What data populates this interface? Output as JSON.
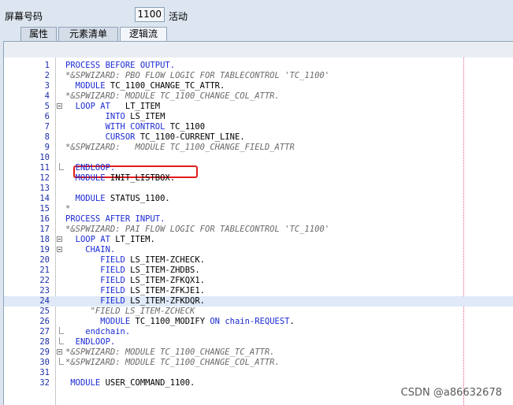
{
  "header": {
    "screen_number_label": "屏幕号码",
    "screen_number_value": "1100",
    "screen_status": "活动"
  },
  "tabs": [
    {
      "label": "属性",
      "active": false
    },
    {
      "label": "元素清单",
      "active": false
    },
    {
      "label": "逻辑流",
      "active": true
    }
  ],
  "code_lines": [
    {
      "n": "1",
      "fold": "",
      "parts": [
        {
          "t": "PROCESS BEFORE OUTPUT.",
          "c": "kw"
        }
      ]
    },
    {
      "n": "2",
      "fold": "",
      "parts": [
        {
          "t": "*&SPWIZARD: PBO FLOW LOGIC FOR TABLECONTROL 'TC_1100'",
          "c": "cm"
        }
      ]
    },
    {
      "n": "3",
      "fold": "",
      "parts": [
        {
          "t": "  MODULE",
          "c": "kw"
        },
        {
          "t": " TC_1100_CHANGE_TC_ATTR.",
          "c": ""
        }
      ]
    },
    {
      "n": "4",
      "fold": "",
      "parts": [
        {
          "t": "*&SPWIZARD: MODULE TC_1100_CHANGE_COL_ATTR.",
          "c": "cm"
        }
      ]
    },
    {
      "n": "5",
      "fold": "open",
      "parts": [
        {
          "t": "  LOOP AT",
          "c": "kw"
        },
        {
          "t": "   LT_ITEM",
          "c": ""
        }
      ]
    },
    {
      "n": "6",
      "fold": "",
      "parts": [
        {
          "t": "        INTO",
          "c": "kw"
        },
        {
          "t": " LS_ITEM",
          "c": ""
        }
      ]
    },
    {
      "n": "7",
      "fold": "",
      "parts": [
        {
          "t": "        WITH CONTROL",
          "c": "kw"
        },
        {
          "t": " TC_1100",
          "c": ""
        }
      ]
    },
    {
      "n": "8",
      "fold": "",
      "parts": [
        {
          "t": "        CURSOR",
          "c": "kw"
        },
        {
          "t": " TC_1100-CURRENT_LINE.",
          "c": ""
        }
      ]
    },
    {
      "n": "9",
      "fold": "",
      "parts": [
        {
          "t": "*&SPWIZARD:   MODULE TC_1100_CHANGE_FIELD_ATTR",
          "c": "cm"
        }
      ]
    },
    {
      "n": "10",
      "fold": "",
      "parts": []
    },
    {
      "n": "11",
      "fold": "end",
      "parts": [
        {
          "t": "  ENDLOOP.",
          "c": "kw"
        }
      ]
    },
    {
      "n": "12",
      "fold": "",
      "parts": [
        {
          "t": "  MODULE",
          "c": "kw"
        },
        {
          "t": " INIT_LISTBOX.",
          "c": ""
        }
      ]
    },
    {
      "n": "13",
      "fold": "",
      "parts": []
    },
    {
      "n": "14",
      "fold": "",
      "parts": [
        {
          "t": "  MODULE",
          "c": "kw"
        },
        {
          "t": " STATUS_1100.",
          "c": ""
        }
      ]
    },
    {
      "n": "15",
      "fold": "",
      "parts": [
        {
          "t": "*",
          "c": "cm"
        }
      ]
    },
    {
      "n": "16",
      "fold": "",
      "parts": [
        {
          "t": "PROCESS AFTER INPUT.",
          "c": "kw"
        }
      ]
    },
    {
      "n": "17",
      "fold": "",
      "parts": [
        {
          "t": "*&SPWIZARD: PAI FLOW LOGIC FOR TABLECONTROL 'TC_1100'",
          "c": "cm"
        }
      ]
    },
    {
      "n": "18",
      "fold": "open",
      "parts": [
        {
          "t": "  LOOP AT",
          "c": "kw"
        },
        {
          "t": " LT_ITEM.",
          "c": ""
        }
      ]
    },
    {
      "n": "19",
      "fold": "open",
      "parts": [
        {
          "t": "    CHAIN.",
          "c": "kw"
        }
      ]
    },
    {
      "n": "20",
      "fold": "",
      "parts": [
        {
          "t": "       FIELD",
          "c": "kw"
        },
        {
          "t": " LS_ITEM-ZCHECK.",
          "c": ""
        }
      ]
    },
    {
      "n": "21",
      "fold": "",
      "parts": [
        {
          "t": "       FIELD",
          "c": "kw"
        },
        {
          "t": " LS_ITEM-ZHDBS.",
          "c": ""
        }
      ]
    },
    {
      "n": "22",
      "fold": "",
      "parts": [
        {
          "t": "       FIELD",
          "c": "kw"
        },
        {
          "t": " LS_ITEM-ZFKQX1.",
          "c": ""
        }
      ]
    },
    {
      "n": "23",
      "fold": "",
      "parts": [
        {
          "t": "       FIELD",
          "c": "kw"
        },
        {
          "t": " LS_ITEM-ZFKJE1.",
          "c": ""
        }
      ]
    },
    {
      "n": "24",
      "fold": "",
      "hl": true,
      "parts": [
        {
          "t": "       FIELD",
          "c": "kw"
        },
        {
          "t": " LS_ITEM-ZFKDQR.",
          "c": ""
        }
      ]
    },
    {
      "n": "25",
      "fold": "",
      "parts": [
        {
          "t": "     \"FIELD LS_ITEM-ZCHECK",
          "c": "cm"
        }
      ]
    },
    {
      "n": "26",
      "fold": "",
      "parts": [
        {
          "t": "       MODULE",
          "c": "kw"
        },
        {
          "t": " TC_1100_MODIFY ",
          "c": ""
        },
        {
          "t": "ON",
          "c": "kw"
        },
        {
          "t": " ",
          "c": ""
        },
        {
          "t": "chain-REQUEST",
          "c": "kw"
        },
        {
          "t": ".",
          "c": ""
        }
      ]
    },
    {
      "n": "27",
      "fold": "end",
      "parts": [
        {
          "t": "    endchain.",
          "c": "kw"
        }
      ]
    },
    {
      "n": "28",
      "fold": "end",
      "parts": [
        {
          "t": "  ENDLOOP.",
          "c": "kw"
        }
      ]
    },
    {
      "n": "29",
      "fold": "open",
      "parts": [
        {
          "t": "*&SPWIZARD: MODULE TC_1100_CHANGE_TC_ATTR.",
          "c": "cm"
        }
      ]
    },
    {
      "n": "30",
      "fold": "end",
      "parts": [
        {
          "t": "*&SPWIZARD: MODULE TC_1100_CHANGE_COL_ATTR.",
          "c": "cm"
        }
      ]
    },
    {
      "n": "31",
      "fold": "",
      "parts": []
    },
    {
      "n": "32",
      "fold": "",
      "parts": [
        {
          "t": " MODULE",
          "c": "kw"
        },
        {
          "t": " USER_COMMAND_1100.",
          "c": ""
        }
      ]
    }
  ],
  "watermark": "CSDN @a86632678",
  "colors": {
    "keyword": "#1b2bd4",
    "comment": "#6a6a6a",
    "highlight_box": "#e01c1c"
  }
}
